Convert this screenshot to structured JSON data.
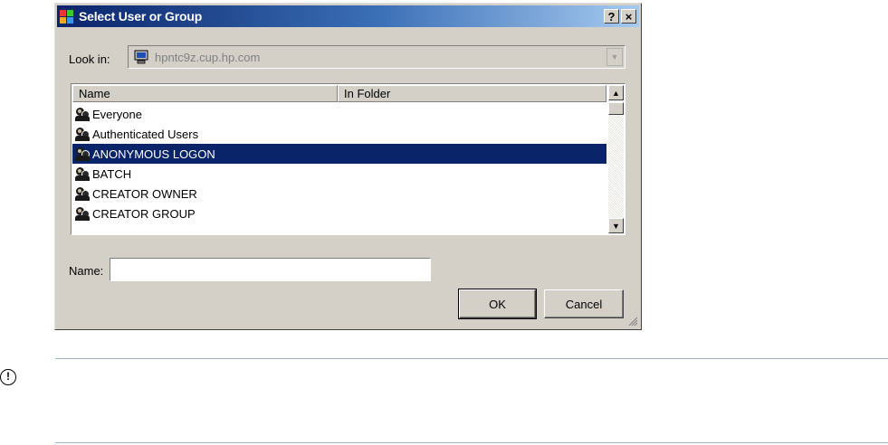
{
  "dialog": {
    "title": "Select User or Group",
    "help_button": "?",
    "close_button": "×",
    "look_in": {
      "label": "Look in:",
      "value": "hpntc9z.cup.hp.com"
    },
    "list": {
      "columns": [
        "Name",
        "In Folder"
      ],
      "rows": [
        {
          "name": "Everyone",
          "folder": ""
        },
        {
          "name": "Authenticated Users",
          "folder": ""
        },
        {
          "name": "ANONYMOUS LOGON",
          "folder": "",
          "selected": true
        },
        {
          "name": "BATCH",
          "folder": ""
        },
        {
          "name": "CREATOR OWNER",
          "folder": ""
        },
        {
          "name": "CREATOR GROUP",
          "folder": ""
        }
      ]
    },
    "name_field": {
      "label": "Name:",
      "value": ""
    },
    "buttons": {
      "ok": "OK",
      "cancel": "Cancel"
    }
  },
  "notice": {
    "icon": "important-icon"
  },
  "colors": {
    "selection": "#0a246a",
    "dialog_face": "#d4d0c8",
    "title_start": "#0a246a",
    "title_end": "#a6caf0",
    "separator": "#9fb6cc"
  }
}
